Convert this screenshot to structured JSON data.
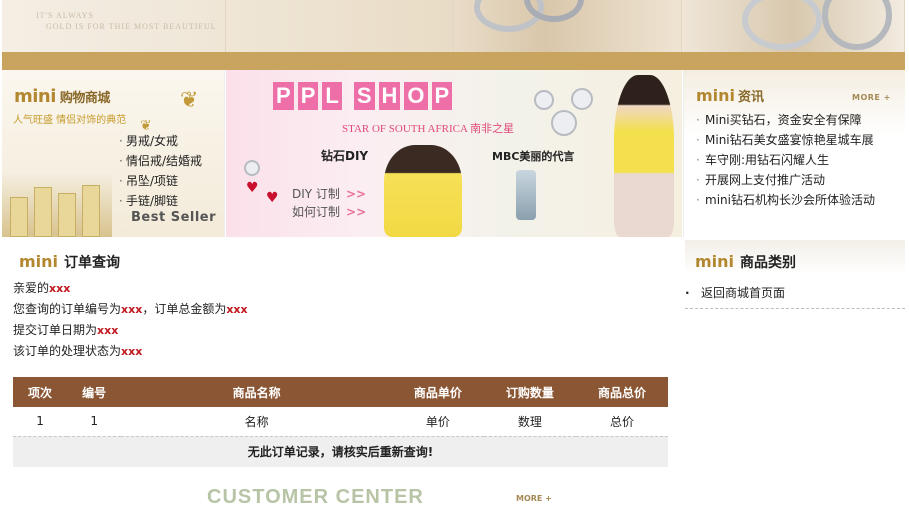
{
  "banner": {
    "tagline_line1": "IT'S ALWAYS",
    "tagline_line2": "GOLD IS FOR THIE MOST BEAUTIFUL"
  },
  "shop_box": {
    "logo": "mini",
    "title": "购物商城",
    "slogan": "人气旺盛  情侣对饰的典范",
    "items": [
      "男戒/女戒",
      "情侣戒/结婚戒",
      "吊坠/项链",
      "手链/脚链"
    ],
    "best_seller": "Best Seller"
  },
  "ppl_banner": {
    "title_chars": [
      "P",
      "P",
      "L",
      "S",
      "H",
      "O",
      "P"
    ],
    "star_text": "STAR OF SOUTH AFRICA 南非之星",
    "diamond_diy": "钻石DIY",
    "mbc_text": "MBC美丽的代言",
    "diy_link": "DIY 订制",
    "how_link": "如何订制",
    "arrow": ">>"
  },
  "news": {
    "logo": "mini",
    "title": "资讯",
    "more": "MORE +",
    "items": [
      "Mini买钻石，资金安全有保障",
      "Mini钻石美女盛宴惊艳星城车展",
      "车守刚:用钻石闪耀人生",
      "开展网上支付推广活动",
      "mini钻石机构长沙会所体验活动"
    ]
  },
  "order": {
    "logo": "mini",
    "title": "订单查询",
    "line1_prefix": "亲爱的",
    "line1_value": "xxx",
    "line2_prefix": "您查询的订单编号为",
    "line2_value": "xxx",
    "line2_mid": "，订单总金额为",
    "line2_value2": "xxx",
    "line3_prefix": "提交订单日期为",
    "line3_value": "xxx",
    "line4_prefix": "该订单的处理状态为",
    "line4_value": "xxx",
    "table": {
      "headers": [
        "项次",
        "编号",
        "商品名称",
        "商品单价",
        "订购数量",
        "商品总价"
      ],
      "row": [
        "1",
        "1",
        "名称",
        "单价",
        "数理",
        "总价"
      ],
      "empty_message": "无此订单记录，请核实后重新查询!"
    },
    "customer_center": "CUSTOMER CENTER",
    "more": "MORE +"
  },
  "category": {
    "logo": "mini",
    "title": "商品类别",
    "items": [
      "返回商城首页面"
    ]
  },
  "colors": {
    "accent_gold": "#b3872f",
    "table_header": "#8a5634",
    "red_value": "#c0181f",
    "brown_bar": "#c8a45e",
    "pink_title": "#ee6fa7"
  }
}
